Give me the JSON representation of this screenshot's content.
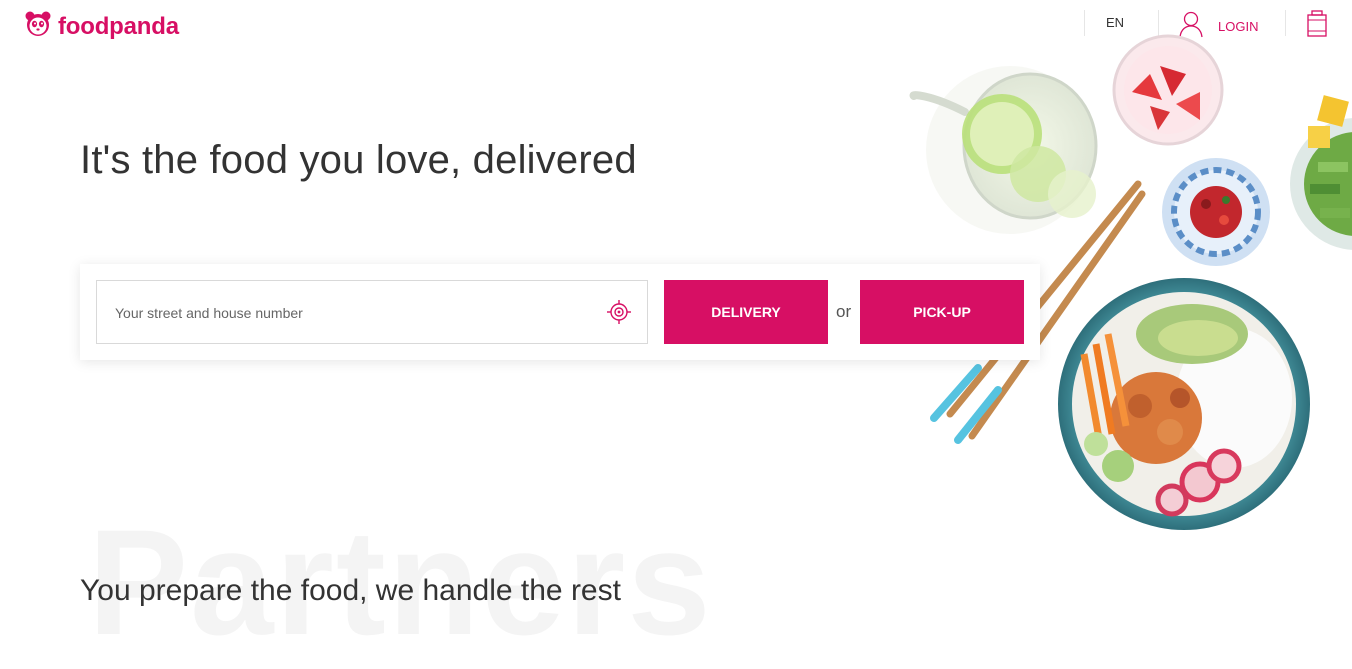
{
  "brand": {
    "name": "foodpanda",
    "color": "#d70f64"
  },
  "header": {
    "language": "EN",
    "login_label": "LOGIN"
  },
  "hero": {
    "title": "It's the food you love, delivered",
    "address_placeholder": "Your street and house number",
    "delivery_label": "DELIVERY",
    "or_label": "or",
    "pickup_label": "PICK-UP"
  },
  "partners": {
    "heading_bg": "Partners",
    "subtitle": "You prepare the food, we handle the rest"
  },
  "icons": [
    "panda-logo-icon",
    "user-icon",
    "cart-icon",
    "locate-icon"
  ]
}
